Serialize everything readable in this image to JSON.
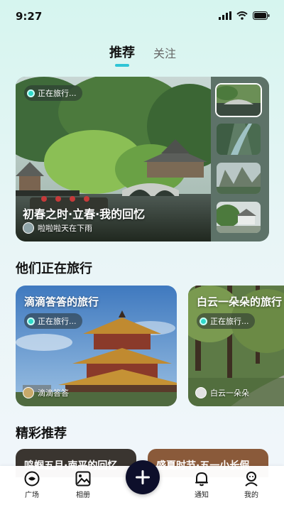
{
  "status_bar": {
    "time": "9:27"
  },
  "tabs": [
    {
      "label": "推荐",
      "active": true
    },
    {
      "label": "关注",
      "active": false
    }
  ],
  "featured": {
    "badge": "正在旅行...",
    "title": "初春之时·立春·我的回忆",
    "author": "啦啦啦天在下雨"
  },
  "sections": {
    "traveling": "他们正在旅行",
    "picks": "精彩推荐"
  },
  "trips": [
    {
      "title": "滴滴答答的旅行",
      "badge": "正在旅行...",
      "author": "滴滴答答"
    },
    {
      "title": "白云一朵朵的旅行",
      "badge": "正在旅行...",
      "author": "白云一朵朵"
    }
  ],
  "picks": [
    {
      "title": "鸣蝈五月·南平的回忆"
    },
    {
      "title": "盛夏时节·五一小长假"
    }
  ],
  "bottom_nav": [
    {
      "label": "广场",
      "icon": "compass-icon"
    },
    {
      "label": "相册",
      "icon": "image-icon"
    },
    {
      "label": "",
      "icon": "plus-icon"
    },
    {
      "label": "通知",
      "icon": "bell-icon"
    },
    {
      "label": "我的",
      "icon": "user-icon"
    }
  ],
  "colors": {
    "accent": "#2fc5d6",
    "nav_add_bg": "#0d0f2b"
  }
}
